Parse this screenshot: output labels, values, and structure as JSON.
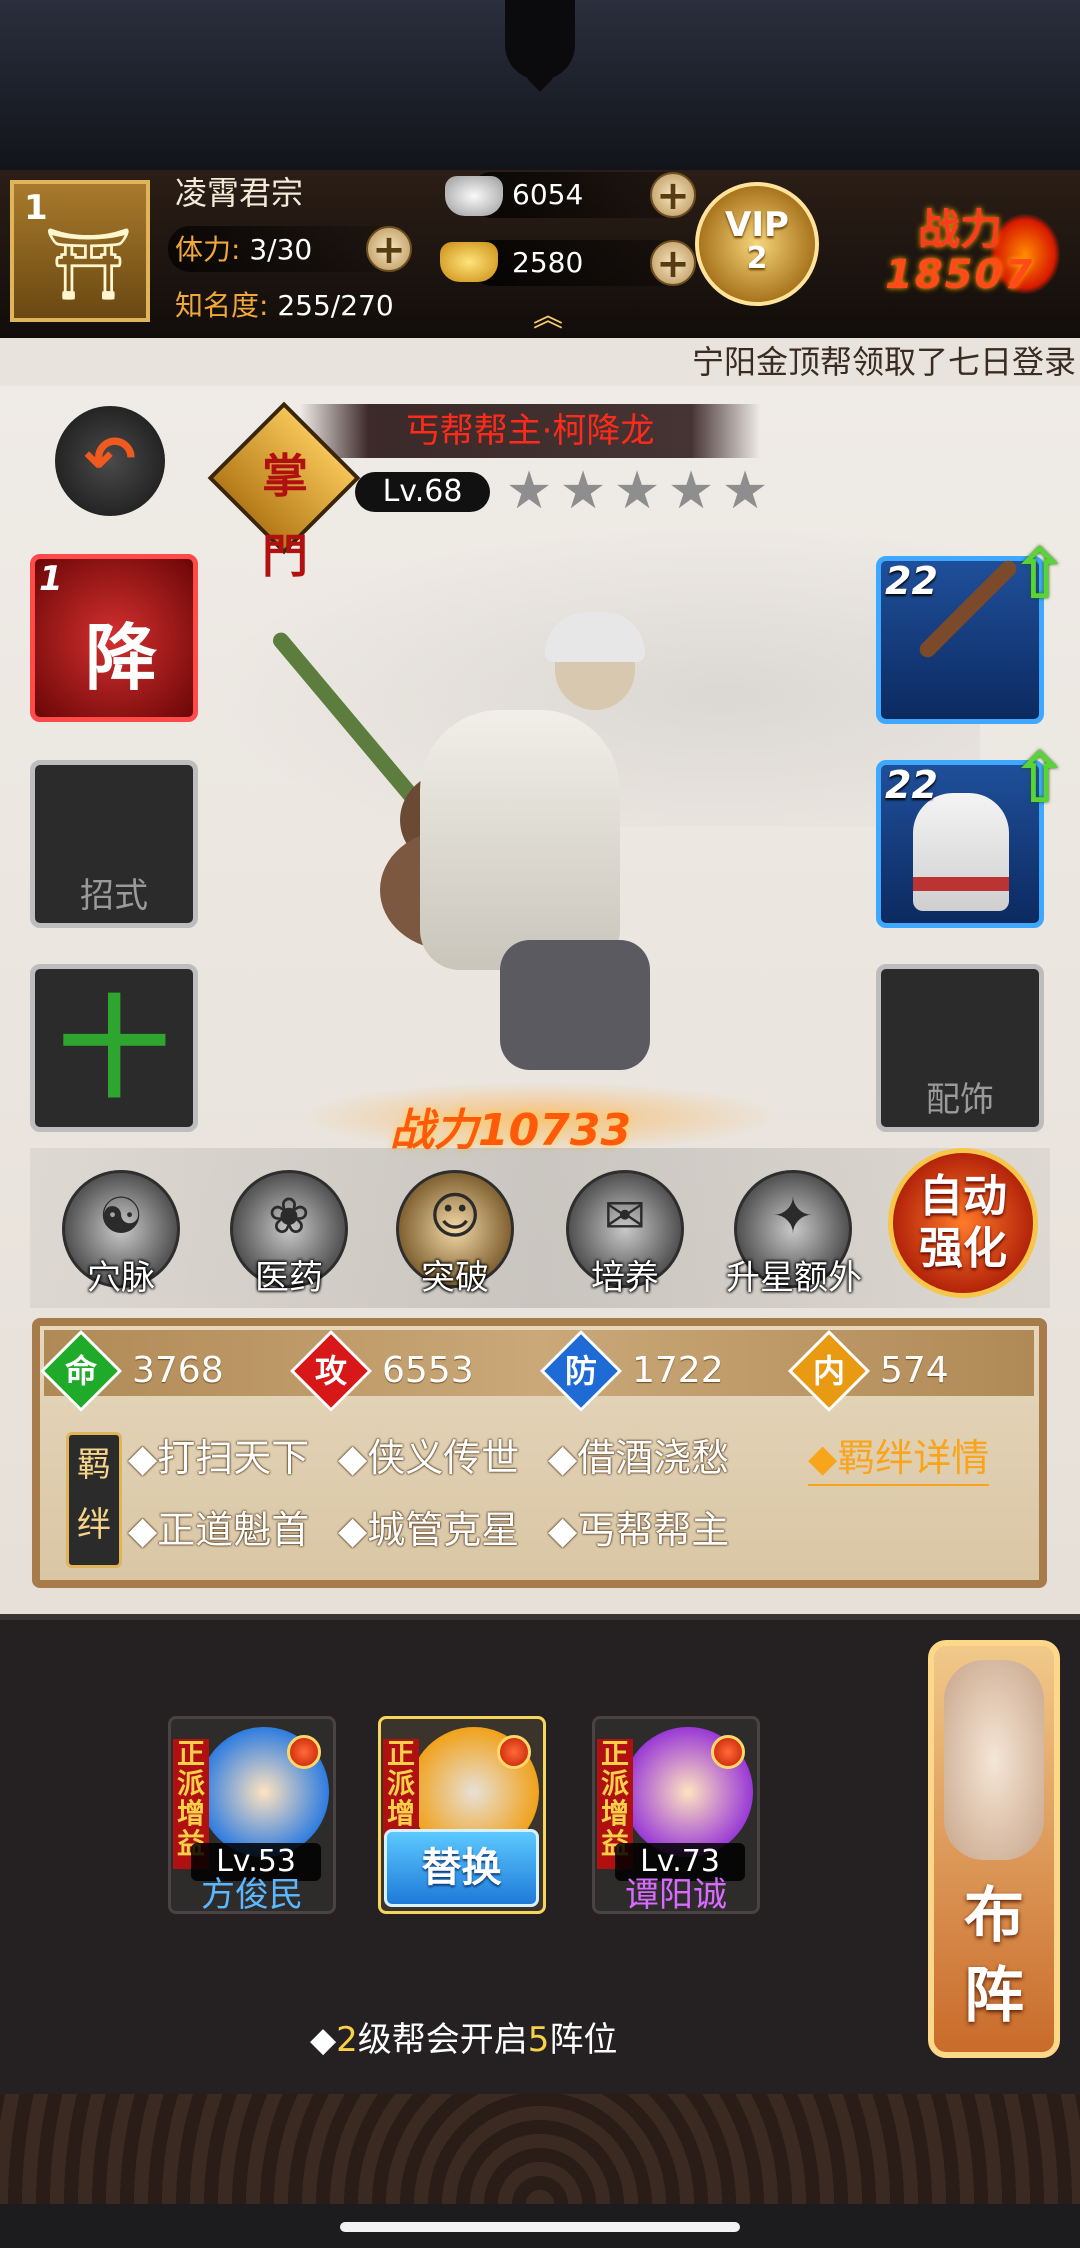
{
  "player": {
    "level": "1",
    "name": "凌霄君宗",
    "stamina_label": "体力:",
    "stamina_value": "3/30",
    "fame_label": "知名度:",
    "fame_value": "255/270"
  },
  "currency": {
    "silver": "6054",
    "gold": "2580",
    "silver_color": "#c9c9c9",
    "gold_color": "#f2b62c"
  },
  "vip": {
    "label": "VIP",
    "level": "2"
  },
  "power_top": {
    "label": "战力",
    "value": "18507"
  },
  "ticker": "宁阳金顶帮领取了七日登录",
  "hero": {
    "title": "丐帮帮主·柯降龙",
    "emblem": "掌門",
    "level": "Lv.68",
    "stars": [
      "★",
      "★",
      "★",
      "★",
      "★"
    ],
    "power": "战力10733"
  },
  "slots": {
    "skill_number": "1",
    "skill_char": "降",
    "moves_label": "招式",
    "add_label": "十",
    "accessory_label": "配饰",
    "weapon_level": "22",
    "armor_level": "22"
  },
  "functions": [
    {
      "label": "穴脉",
      "icon": "meridian-icon",
      "glyph": "☯"
    },
    {
      "label": "医药",
      "icon": "medicine-icon",
      "glyph": "❀"
    },
    {
      "label": "突破",
      "icon": "breakthrough-icon",
      "glyph": "☺"
    },
    {
      "label": "培养",
      "icon": "cultivate-icon",
      "glyph": "✉"
    },
    {
      "label": "升星额外",
      "icon": "star-up-icon",
      "glyph": "✦"
    }
  ],
  "auto_strengthen": {
    "line1": "自动",
    "line2": "强化"
  },
  "attributes": [
    {
      "ch": "命",
      "value": "3768",
      "color": "#1faa2a"
    },
    {
      "ch": "攻",
      "value": "6553",
      "color": "#d81818"
    },
    {
      "ch": "防",
      "value": "1722",
      "color": "#1f6bd6"
    },
    {
      "ch": "内",
      "value": "574",
      "color": "#e89a12"
    }
  ],
  "bond": {
    "tag_line1": "羁",
    "tag_line2": "绊",
    "items": [
      "◆打扫天下",
      "◆侠义传世",
      "◆借酒浇愁",
      "◆正道魁首",
      "◆城管克星",
      "◆丐帮帮主"
    ],
    "detail": "◆羁绊详情"
  },
  "team": [
    {
      "tag": "正派增益",
      "level": "Lv.53",
      "name": "方俊民",
      "name_color": "#5bb8ff",
      "ring": "#2f7de0"
    },
    {
      "tag": "正派增",
      "replace": "替换",
      "ring": "#f0a21c"
    },
    {
      "tag": "正派增益",
      "level": "Lv.73",
      "name": "谭阳诚",
      "name_color": "#d86bff",
      "ring": "#9a3ad6"
    }
  ],
  "formation": {
    "line1": "布",
    "line2": "阵"
  },
  "slot_hint": {
    "p1": "◆",
    "n1": "2",
    "p2": "级帮会开启",
    "n2": "5",
    "p3": "阵位"
  }
}
